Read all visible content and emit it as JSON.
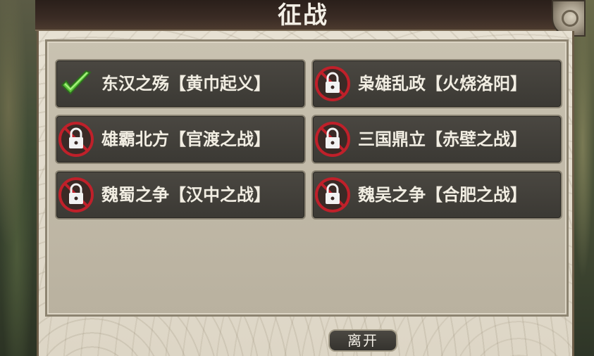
{
  "header": {
    "title": "征战"
  },
  "campaigns": [
    {
      "label": "东汉之殇【黄巾起义】",
      "status": "completed",
      "icon": "checkmark-icon"
    },
    {
      "label": "枭雄乱政【火烧洛阳】",
      "status": "locked",
      "icon": "lock-icon"
    },
    {
      "label": "雄霸北方【官渡之战】",
      "status": "locked",
      "icon": "lock-icon"
    },
    {
      "label": "三国鼎立【赤壁之战】",
      "status": "locked",
      "icon": "lock-icon"
    },
    {
      "label": "魏蜀之争【汉中之战】",
      "status": "locked",
      "icon": "lock-icon"
    },
    {
      "label": "魏吴之争【合肥之战】",
      "status": "locked",
      "icon": "lock-icon"
    }
  ],
  "footer": {
    "exit_label": "离开"
  },
  "colors": {
    "tile_bg": "#3b3934",
    "lock_red": "#c0202a",
    "check_green": "#5cc53a",
    "parchment": "#e7e1d3"
  }
}
